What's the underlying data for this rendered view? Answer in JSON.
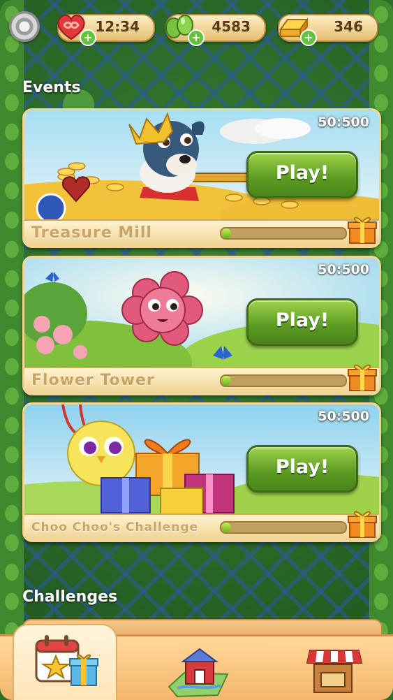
{
  "topbar": {
    "settings_icon": "gear-icon",
    "lives": {
      "value": "12:34",
      "icon": "infinite-heart-icon"
    },
    "beans": {
      "value": "4583",
      "icon": "magic-bean-icon"
    },
    "gold": {
      "value": "346",
      "icon": "gold-bar-icon"
    }
  },
  "sections": {
    "events_title": "Events",
    "challenges_title": "Challenges"
  },
  "events": [
    {
      "name": "Treasure Mill",
      "timer": "50:500",
      "play_label": "Play!",
      "progress": 0.05
    },
    {
      "name": "Flower Tower",
      "timer": "50:500",
      "play_label": "Play!",
      "progress": 0.05
    },
    {
      "name": "Choo Choo's Challenge",
      "timer": "50:500",
      "play_label": "Play!",
      "progress": 0.05
    }
  ],
  "bottomnav": {
    "tabs": [
      {
        "icon": "events-calendar-icon",
        "active": true
      },
      {
        "icon": "farm-map-icon",
        "active": false
      },
      {
        "icon": "market-stall-icon",
        "active": false
      }
    ]
  },
  "colors": {
    "play_button": "#6aa82a",
    "card_label": "#c9a565",
    "progress_fill": "#8fd03a"
  }
}
